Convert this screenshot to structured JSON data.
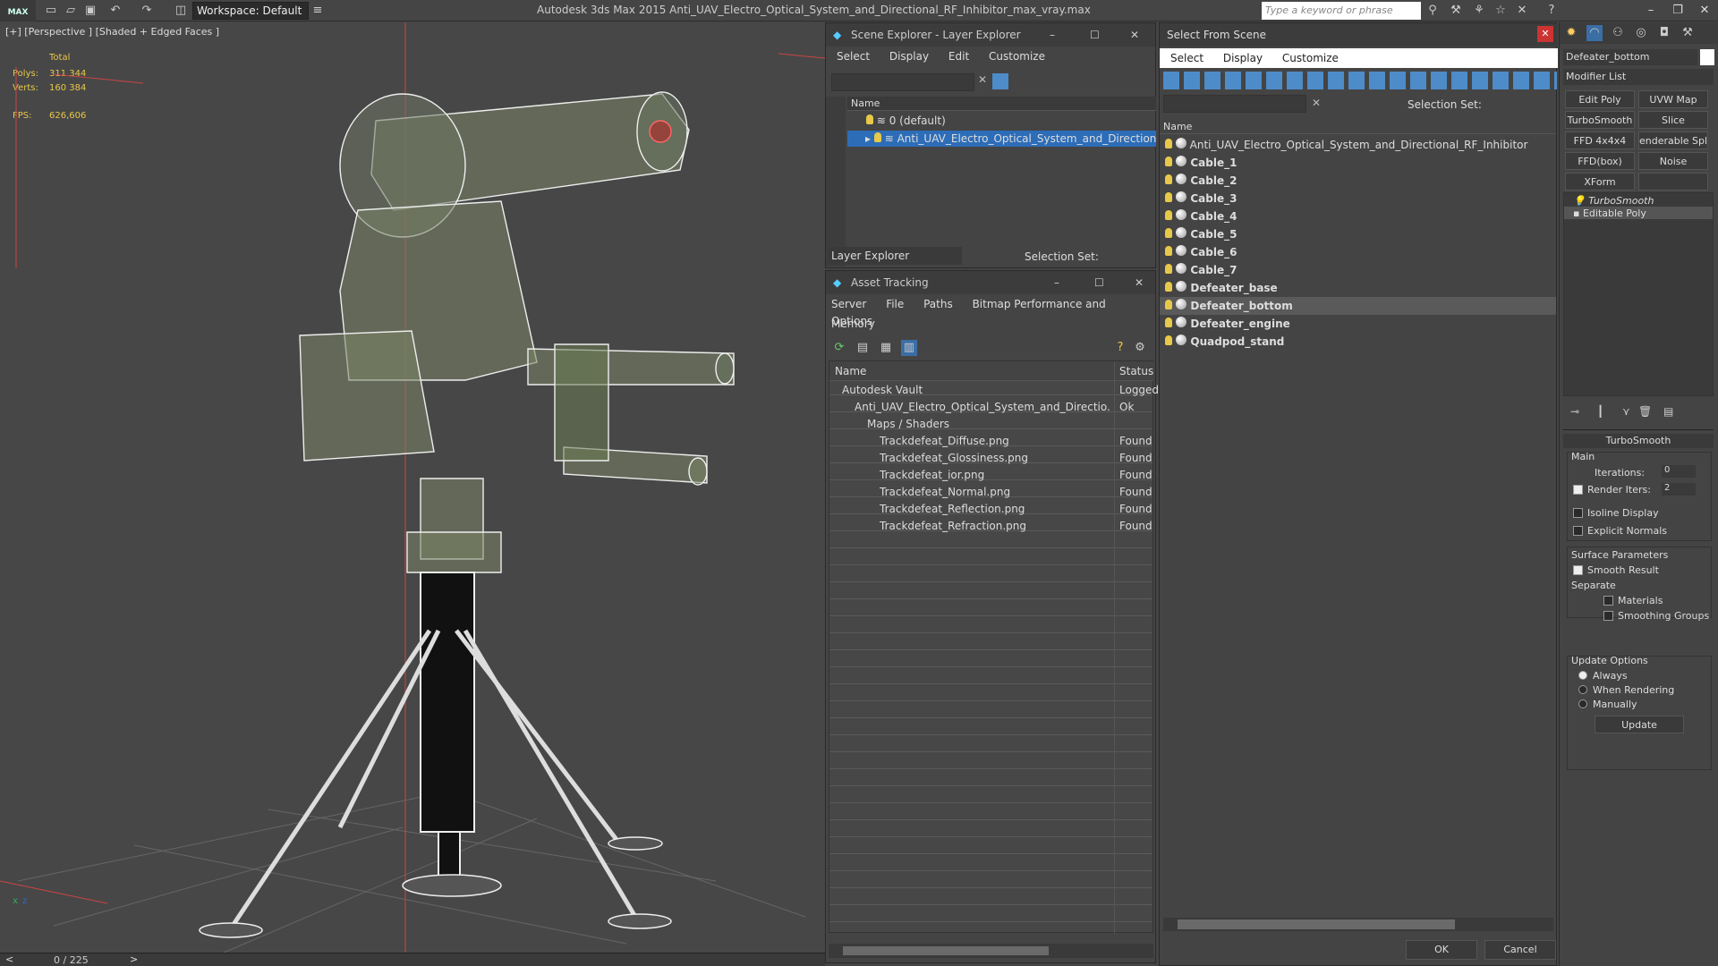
{
  "titlebar": {
    "logo": "MAX",
    "workspace_label": "Workspace: Default",
    "app_title": "Autodesk 3ds Max  2015    Anti_UAV_Electro_Optical_System_and_Directional_RF_Inhibitor_max_vray.max",
    "search_placeholder": "Type a keyword or phrase"
  },
  "viewport": {
    "label": "[+] [Perspective ] [Shaded + Edged Faces ]",
    "stats": {
      "total_label": "Total",
      "polys_label": "Polys:",
      "polys": "311 344",
      "verts_label": "Verts:",
      "verts": "160 384",
      "fps_label": "FPS:",
      "fps": "626,606"
    },
    "axis_x": "x",
    "axis_z": "z"
  },
  "timeslider": {
    "value": "0 / 225",
    "prev": "<",
    "next": ">"
  },
  "scene_explorer": {
    "title": "Scene Explorer - Layer Explorer",
    "menu": [
      "Select",
      "Display",
      "Edit",
      "Customize"
    ],
    "column_name": "Name",
    "rows": [
      "0 (default)",
      "Anti_UAV_Electro_Optical_System_and_Directional_RF_I..."
    ],
    "footer_dropdown": "Layer Explorer",
    "footer_selection_set": "Selection Set:"
  },
  "asset_tracking": {
    "title": "Asset Tracking",
    "menu": [
      "Server",
      "File",
      "Paths",
      "Bitmap Performance and Memory"
    ],
    "menu2": "Options",
    "col_name": "Name",
    "col_status": "Status",
    "rows": [
      {
        "name": "Autodesk Vault",
        "status": "Logged",
        "indent": 0
      },
      {
        "name": "Anti_UAV_Electro_Optical_System_and_Directio...",
        "status": "Ok",
        "indent": 1
      },
      {
        "name": "Maps / Shaders",
        "status": "",
        "indent": 2
      },
      {
        "name": "Trackdefeat_Diffuse.png",
        "status": "Found",
        "indent": 3
      },
      {
        "name": "Trackdefeat_Glossiness.png",
        "status": "Found",
        "indent": 3
      },
      {
        "name": "Trackdefeat_ior.png",
        "status": "Found",
        "indent": 3
      },
      {
        "name": "Trackdefeat_Normal.png",
        "status": "Found",
        "indent": 3
      },
      {
        "name": "Trackdefeat_Reflection.png",
        "status": "Found",
        "indent": 3
      },
      {
        "name": "Trackdefeat_Refraction.png",
        "status": "Found",
        "indent": 3
      }
    ]
  },
  "select_from_scene": {
    "title": "Select From Scene",
    "menu": [
      "Select",
      "Display",
      "Customize"
    ],
    "selection_set": "Selection Set:",
    "column_name": "Name",
    "items": [
      "Anti_UAV_Electro_Optical_System_and_Directional_RF_Inhibitor",
      "Cable_1",
      "Cable_2",
      "Cable_3",
      "Cable_4",
      "Cable_5",
      "Cable_6",
      "Cable_7",
      "Defeater_base",
      "Defeater_bottom",
      "Defeater_engine",
      "Quadpod_stand"
    ],
    "selected_index": 9,
    "ok": "OK",
    "cancel": "Cancel"
  },
  "command_panel": {
    "object_name": "Defeater_bottom",
    "modifier_list": "Modifier List",
    "buttons": [
      "Edit Poly",
      "UVW Map",
      "TurboSmooth",
      "Slice",
      "FFD 4x4x4",
      "enderable Splir",
      "FFD(box)",
      "Noise",
      "XForm",
      ""
    ],
    "stack": [
      "TurboSmooth",
      "Editable Poly"
    ],
    "rollout_title": "TurboSmooth",
    "main_label": "Main",
    "iterations_label": "Iterations:",
    "iterations": "0",
    "render_iters_label": "Render Iters:",
    "render_iters": "2",
    "isoline": "Isoline Display",
    "explicit": "Explicit Normals",
    "surface_params": "Surface Parameters",
    "smooth_result": "Smooth Result",
    "separate": "Separate",
    "materials": "Materials",
    "smoothing_groups": "Smoothing Groups",
    "update_options": "Update Options",
    "always": "Always",
    "when_rendering": "When Rendering",
    "manually": "Manually",
    "update": "Update"
  }
}
